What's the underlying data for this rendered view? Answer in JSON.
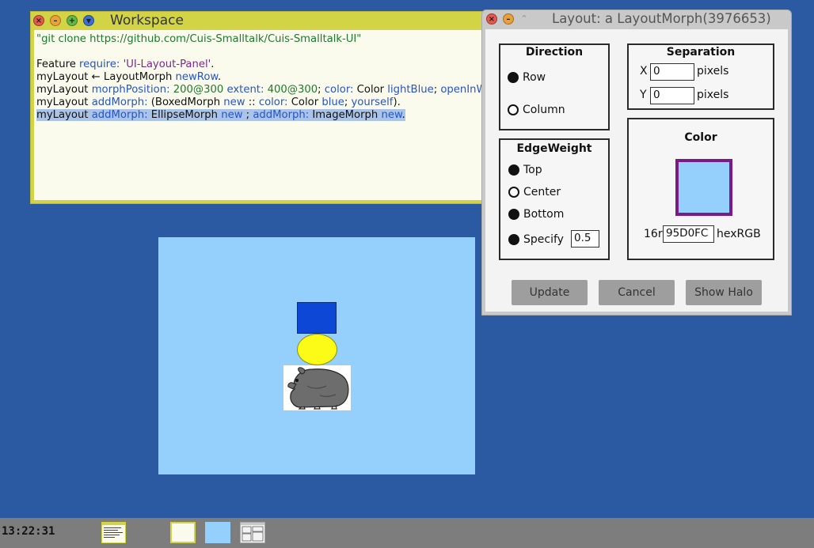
{
  "workspace": {
    "title": "Workspace",
    "lines": [
      [
        {
          "t": "\"git clone https://github.com/Cuis-Smalltalk/Cuis-Smalltalk-UI\"",
          "c": "tok-str"
        }
      ],
      [
        {
          "t": " ",
          "c": ""
        }
      ],
      [
        {
          "t": "Feature ",
          "c": ""
        },
        {
          "t": "require: ",
          "c": "tok-kw"
        },
        {
          "t": "'UI-Layout-Panel'",
          "c": "tok-lit"
        },
        {
          "t": ".",
          "c": ""
        }
      ],
      [
        {
          "t": "myLayout ← LayoutMorph ",
          "c": ""
        },
        {
          "t": "newRow",
          "c": "tok-kw"
        },
        {
          "t": ".",
          "c": ""
        }
      ],
      [
        {
          "t": "myLayout ",
          "c": ""
        },
        {
          "t": "morphPosition: ",
          "c": "tok-kw"
        },
        {
          "t": "200@300 ",
          "c": "tok-num"
        },
        {
          "t": "extent: ",
          "c": "tok-kw"
        },
        {
          "t": "400@300",
          "c": "tok-num"
        },
        {
          "t": "; ",
          "c": ""
        },
        {
          "t": "color: ",
          "c": "tok-kw"
        },
        {
          "t": "Color ",
          "c": ""
        },
        {
          "t": "lightBlue",
          "c": "tok-kw"
        },
        {
          "t": "; ",
          "c": ""
        },
        {
          "t": "openInWorld",
          "c": "tok-kw"
        }
      ],
      [
        {
          "t": "myLayout ",
          "c": ""
        },
        {
          "t": "addMorph: ",
          "c": "tok-kw"
        },
        {
          "t": "(BoxedMorph ",
          "c": ""
        },
        {
          "t": "new ",
          "c": "tok-kw"
        },
        {
          "t": ":: ",
          "c": ""
        },
        {
          "t": "color: ",
          "c": "tok-kw"
        },
        {
          "t": "Color ",
          "c": ""
        },
        {
          "t": "blue",
          "c": "tok-kw"
        },
        {
          "t": "; ",
          "c": ""
        },
        {
          "t": "yourself",
          "c": "tok-kw"
        },
        {
          "t": ").",
          "c": ""
        }
      ],
      [
        {
          "t": "myLayout ",
          "c": ""
        },
        {
          "t": "addMorph: ",
          "c": "tok-kw"
        },
        {
          "t": "EllipseMorph ",
          "c": ""
        },
        {
          "t": "new ",
          "c": "tok-kw"
        },
        {
          "t": "; ",
          "c": ""
        },
        {
          "t": "addMorph: ",
          "c": "tok-kw"
        },
        {
          "t": "ImageMorph ",
          "c": ""
        },
        {
          "t": "new",
          "c": "tok-kw"
        },
        {
          "t": ".",
          "c": ""
        }
      ]
    ],
    "selected_line": 6
  },
  "layout_window": {
    "title": "Layout: a LayoutMorph(3976653)",
    "direction": {
      "title": "Direction",
      "row_label": "Row",
      "column_label": "Column",
      "selected": "Row"
    },
    "separation": {
      "title": "Separation",
      "x_label": "X",
      "x_value": "0",
      "y_label": "Y",
      "y_value": "0",
      "unit_label": "pixels"
    },
    "edge_weight": {
      "title": "EdgeWeight",
      "top_label": "Top",
      "center_label": "Center",
      "bottom_label": "Bottom",
      "specify_label": "Specify",
      "specify_value": "0.5"
    },
    "color": {
      "title": "Color",
      "prefix": "16r",
      "hex_value": "95D0FC",
      "suffix": "hexRGB",
      "swatch_color": "#95d0fc"
    },
    "buttons": {
      "update": "Update",
      "cancel": "Cancel",
      "show_halo": "Show Halo"
    }
  },
  "desktop_panel": {
    "color": "#95d0fc",
    "box_color": "#0d47d6",
    "ellipse_color": "#fbfb17"
  },
  "taskbar": {
    "clock": "13:22:31"
  }
}
